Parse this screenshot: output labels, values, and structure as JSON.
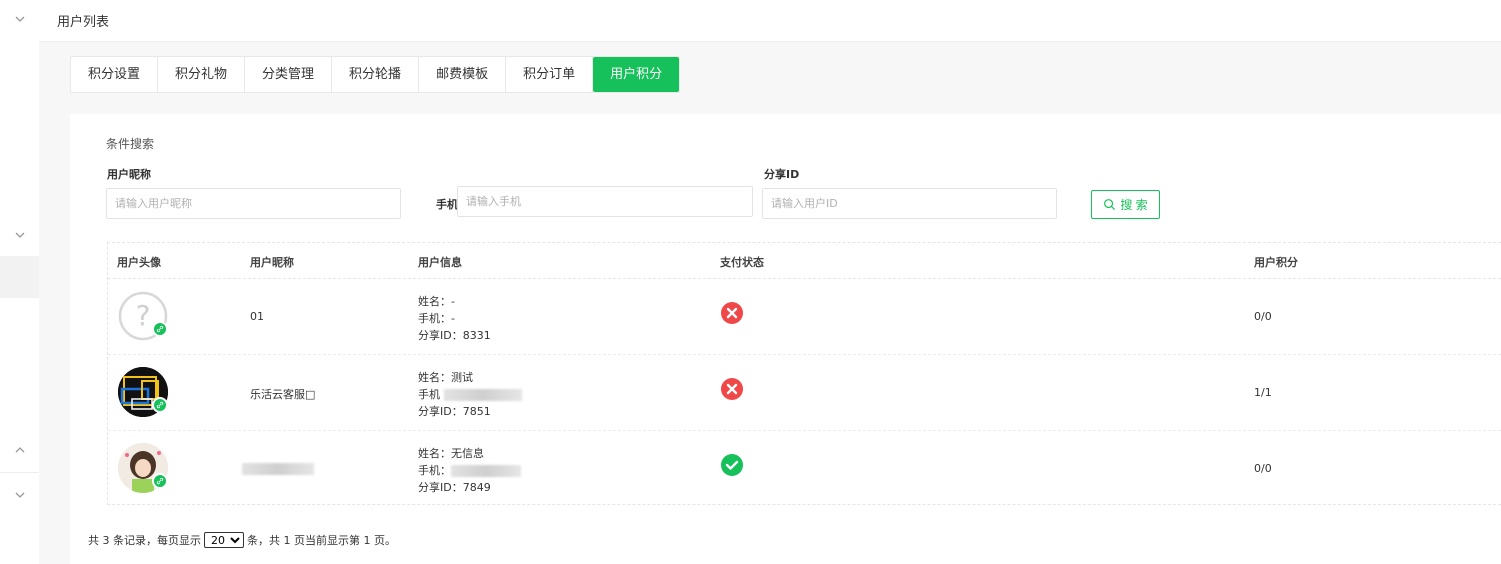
{
  "header": {
    "title": "用户列表"
  },
  "tabs": [
    {
      "label": "积分设置",
      "active": false
    },
    {
      "label": "积分礼物",
      "active": false
    },
    {
      "label": "分类管理",
      "active": false
    },
    {
      "label": "积分轮播",
      "active": false
    },
    {
      "label": "邮费模板",
      "active": false
    },
    {
      "label": "积分订单",
      "active": false
    },
    {
      "label": "用户积分",
      "active": true
    }
  ],
  "search": {
    "title": "条件搜索",
    "nickname_label": "用户昵称",
    "nickname_placeholder": "请输入用户昵称",
    "phone_label": "手机",
    "phone_placeholder": "请输入手机",
    "share_label": "分享ID",
    "share_placeholder": "请输入用户ID",
    "button_label": "搜 索"
  },
  "table": {
    "columns": [
      "用户头像",
      "用户昵称",
      "用户信息",
      "支付状态",
      "用户积分"
    ],
    "rows": [
      {
        "nickname": "01",
        "name": "姓名：-",
        "phone": "手机：-",
        "share": "分享ID：8331",
        "paid": false,
        "points": "0/0"
      },
      {
        "nickname": "乐活云客服□",
        "name": "姓名：测试",
        "phone": "手机",
        "share": "分享ID：7851",
        "paid": true,
        "points": "1/1"
      },
      {
        "nickname": "",
        "name": "姓名：无信息",
        "phone": "手机：",
        "share": "分享ID：7849",
        "paid": true,
        "points": "0/0"
      }
    ]
  },
  "pagination": {
    "prefix": "共 3 条记录，每页显示",
    "page_size": "20",
    "suffix": "条，共 1 页当前显示第 1 页。"
  },
  "colors": {
    "accent": "#16c05a",
    "error": "#f04848",
    "success": "#16c05a"
  },
  "icons": [
    "chevron-down-icon",
    "chevron-up-icon",
    "search-icon",
    "link-icon",
    "close-circle-icon",
    "check-circle-icon"
  ]
}
